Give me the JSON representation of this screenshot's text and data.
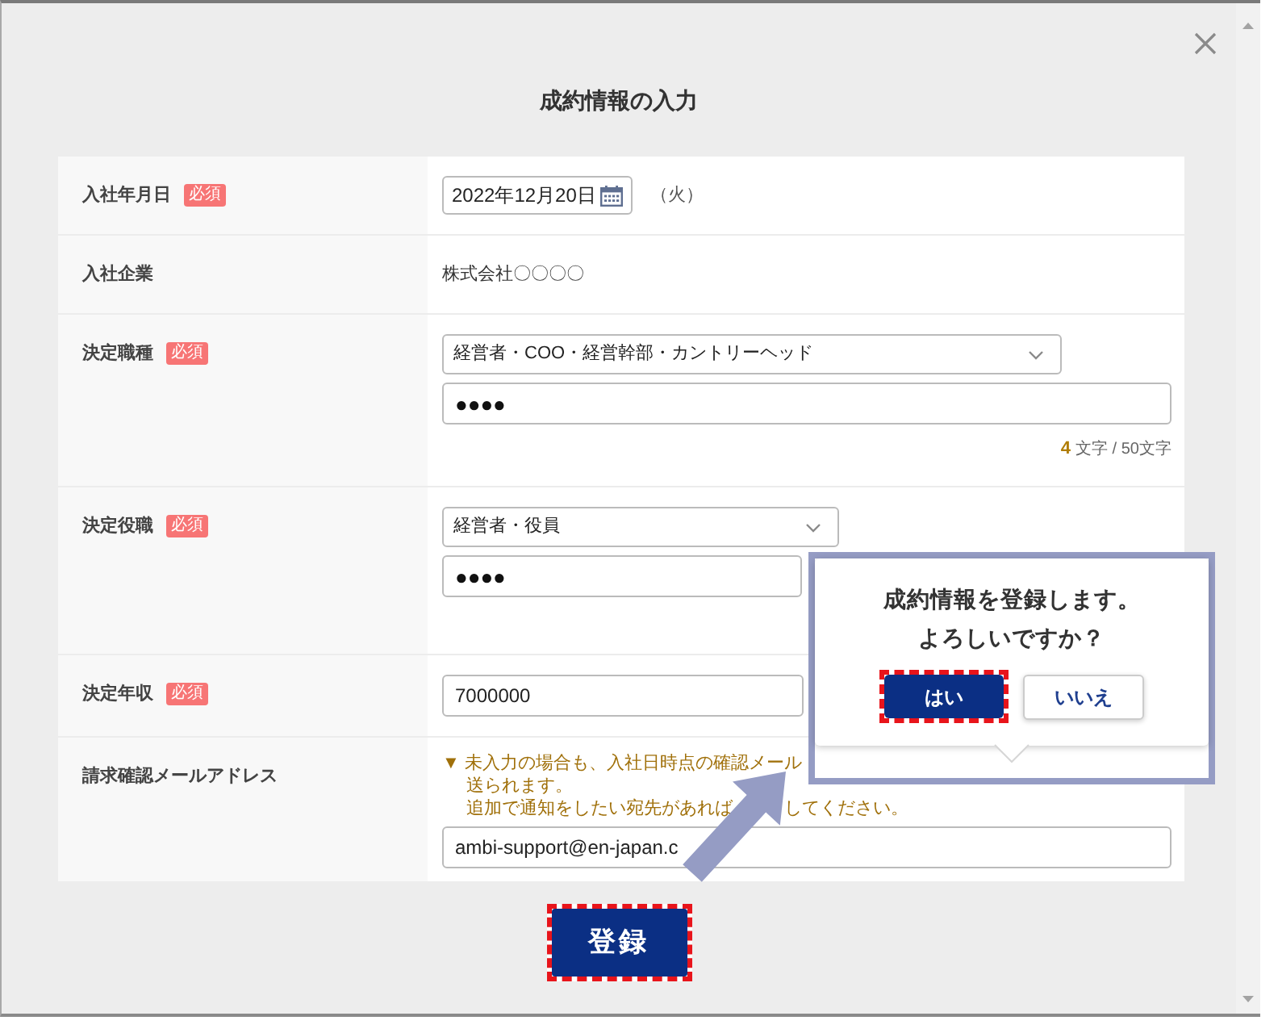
{
  "dialog": {
    "title": "成約情報の入力"
  },
  "form": {
    "rows": [
      {
        "label": "入社年月日",
        "badge": "必須",
        "kind": "date",
        "value": "2022年12月20日",
        "suffix": "（火）"
      },
      {
        "label": "入社企業",
        "kind": "text",
        "value": "株式会社〇〇〇〇"
      },
      {
        "label": "決定職種",
        "badge": "必須",
        "kind": "select_input",
        "select": "経営者・COO・経営幹部・カントリーヘッド",
        "input": "●●●●",
        "counter": {
          "count": "4",
          "text": "文字 / 50文字"
        }
      },
      {
        "label": "決定役職",
        "badge": "必須",
        "kind": "select_input",
        "select": "経営者・役員",
        "input": "●●●●"
      },
      {
        "label": "決定年収",
        "badge": "必須",
        "kind": "input",
        "value": "7000000"
      },
      {
        "label": "請求確認メールアドレス",
        "kind": "email",
        "note": {
          "lines": [
            {
              "parts": [
                "▼ 未入力の場合も、入社日時点の確認メール"
              ]
            },
            {
              "parts": [
                "送られます。"
              ]
            },
            {
              "parts": [
                "追加で通知をしたい宛先があれば",
                "してください。"
              ]
            }
          ]
        },
        "value": "ambi-support@en-japan.c"
      }
    ]
  },
  "submit": {
    "label": "登録",
    "highlighted": true
  },
  "confirm_popover": {
    "message_lines": [
      "成約情報を登録します。",
      "よろしいですか？"
    ],
    "buttons": [
      {
        "label": "はい",
        "kind": "primary",
        "highlighted": true
      },
      {
        "label": "いいえ",
        "kind": "secondary",
        "highlighted": false
      }
    ]
  }
}
